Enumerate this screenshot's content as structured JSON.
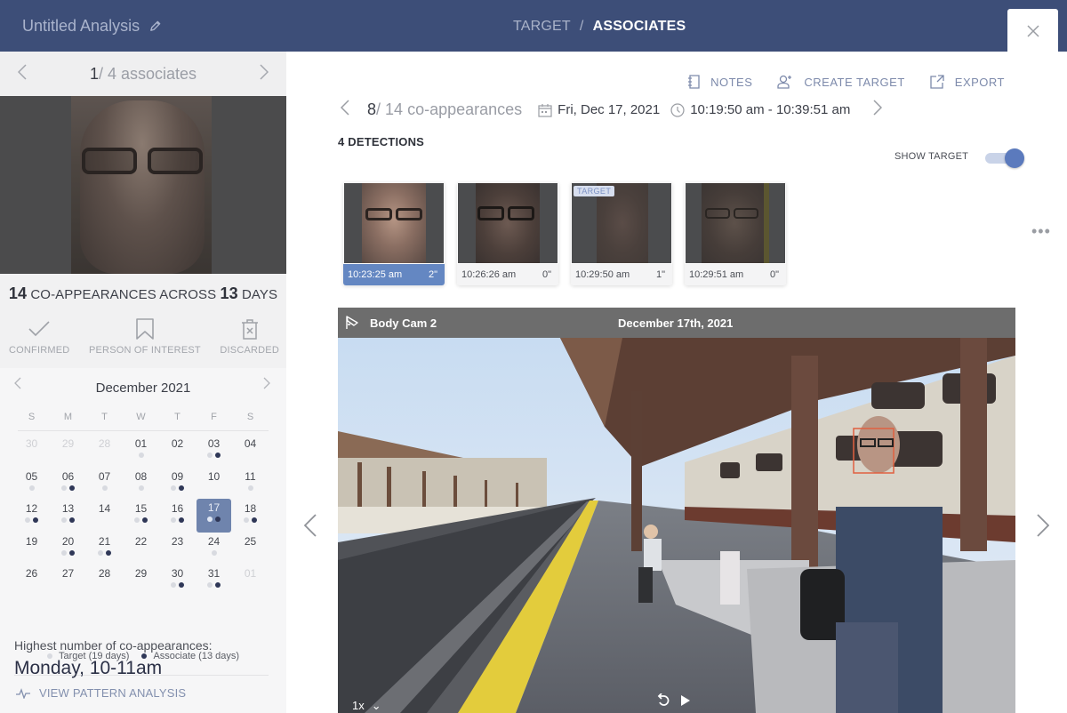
{
  "header": {
    "title": "Untitled Analysis",
    "breadcrumb": [
      "TARGET",
      "/",
      "ASSOCIATES"
    ],
    "close_label": "×"
  },
  "left_panel": {
    "associate_nav": {
      "current": "1",
      "separator": "/",
      "total_label": "4 associates"
    },
    "summary": {
      "coappearances": "14",
      "text1": "CO-APPEARANCES ACROSS",
      "days": "13",
      "text2": "DAYS"
    },
    "status_buttons": [
      {
        "label": "CONFIRMED",
        "icon": "check-icon"
      },
      {
        "label": "PERSON OF INTEREST",
        "icon": "bookmark-icon"
      },
      {
        "label": "DISCARDED",
        "icon": "discard-icon"
      }
    ],
    "calendar": {
      "month_label": "December 2021",
      "weekdays": [
        "S",
        "M",
        "T",
        "W",
        "T",
        "F",
        "S"
      ],
      "days": [
        {
          "d": "30",
          "muted": true,
          "t": false,
          "a": false
        },
        {
          "d": "29",
          "muted": true,
          "t": false,
          "a": false
        },
        {
          "d": "28",
          "muted": true,
          "t": false,
          "a": false
        },
        {
          "d": "01",
          "muted": false,
          "t": true,
          "a": false
        },
        {
          "d": "02",
          "muted": false,
          "t": false,
          "a": false
        },
        {
          "d": "03",
          "muted": false,
          "t": true,
          "a": true
        },
        {
          "d": "04",
          "muted": false,
          "t": false,
          "a": false
        },
        {
          "d": "05",
          "muted": false,
          "t": true,
          "a": false
        },
        {
          "d": "06",
          "muted": false,
          "t": true,
          "a": true
        },
        {
          "d": "07",
          "muted": false,
          "t": true,
          "a": false
        },
        {
          "d": "08",
          "muted": false,
          "t": true,
          "a": false
        },
        {
          "d": "09",
          "muted": false,
          "t": true,
          "a": true
        },
        {
          "d": "10",
          "muted": false,
          "t": false,
          "a": false
        },
        {
          "d": "11",
          "muted": false,
          "t": true,
          "a": false
        },
        {
          "d": "12",
          "muted": false,
          "t": true,
          "a": true
        },
        {
          "d": "13",
          "muted": false,
          "t": true,
          "a": true
        },
        {
          "d": "14",
          "muted": false,
          "t": false,
          "a": false
        },
        {
          "d": "15",
          "muted": false,
          "t": true,
          "a": true
        },
        {
          "d": "16",
          "muted": false,
          "t": true,
          "a": true
        },
        {
          "d": "17",
          "muted": false,
          "t": true,
          "a": true,
          "selected": true
        },
        {
          "d": "18",
          "muted": false,
          "t": true,
          "a": true
        },
        {
          "d": "19",
          "muted": false,
          "t": false,
          "a": false
        },
        {
          "d": "20",
          "muted": false,
          "t": true,
          "a": true
        },
        {
          "d": "21",
          "muted": false,
          "t": true,
          "a": true
        },
        {
          "d": "22",
          "muted": false,
          "t": false,
          "a": false
        },
        {
          "d": "23",
          "muted": false,
          "t": false,
          "a": false
        },
        {
          "d": "24",
          "muted": false,
          "t": true,
          "a": false
        },
        {
          "d": "25",
          "muted": false,
          "t": false,
          "a": false
        },
        {
          "d": "26",
          "muted": false,
          "t": false,
          "a": false
        },
        {
          "d": "27",
          "muted": false,
          "t": false,
          "a": false
        },
        {
          "d": "28",
          "muted": false,
          "t": false,
          "a": false
        },
        {
          "d": "29",
          "muted": false,
          "t": false,
          "a": false
        },
        {
          "d": "30",
          "muted": false,
          "t": true,
          "a": true
        },
        {
          "d": "31",
          "muted": false,
          "t": true,
          "a": true
        },
        {
          "d": "01",
          "muted": true,
          "t": false,
          "a": false
        }
      ],
      "legend": {
        "target": "Target (19 days)",
        "associate": "Associate (13 days)"
      },
      "colors": {
        "target_dot": "#d8dae0",
        "associate_dot": "#2f3757",
        "selected_bg": "#6f84ad"
      }
    },
    "highest": {
      "label": "Highest number of co-appearances:",
      "value": "Monday, 10-11am"
    },
    "pattern_link": "VIEW PATTERN ANALYSIS"
  },
  "main": {
    "actions": [
      {
        "label": "NOTES",
        "icon": "notes-icon"
      },
      {
        "label": "CREATE TARGET",
        "icon": "add-person-icon"
      },
      {
        "label": "EXPORT",
        "icon": "export-icon"
      }
    ],
    "coapp_nav": {
      "current": "8",
      "separator": "/",
      "total_label": "14 co-appearances",
      "date": "Fri, Dec 17, 2021",
      "time_range": "10:19:50 am - 10:39:51 am"
    },
    "detections_title": "4 DETECTIONS",
    "show_target": {
      "label": "SHOW TARGET",
      "on": true
    },
    "more_label": "•••",
    "detections": [
      {
        "time": "10:23:25 am",
        "duration": "2\"",
        "selected": true,
        "tag": ""
      },
      {
        "time": "10:26:26 am",
        "duration": "0\"",
        "selected": false,
        "tag": ""
      },
      {
        "time": "10:29:50 am",
        "duration": "1\"",
        "selected": false,
        "tag": "TARGET"
      },
      {
        "time": "10:29:51 am",
        "duration": "0\"",
        "selected": false,
        "tag": ""
      }
    ],
    "video": {
      "camera": "Body Cam 2",
      "date": "December 17th, 2021",
      "speed": "1x",
      "speed_chevron": "⌄"
    },
    "accent_color": "#6487c2",
    "header_color": "#3d4e78"
  }
}
